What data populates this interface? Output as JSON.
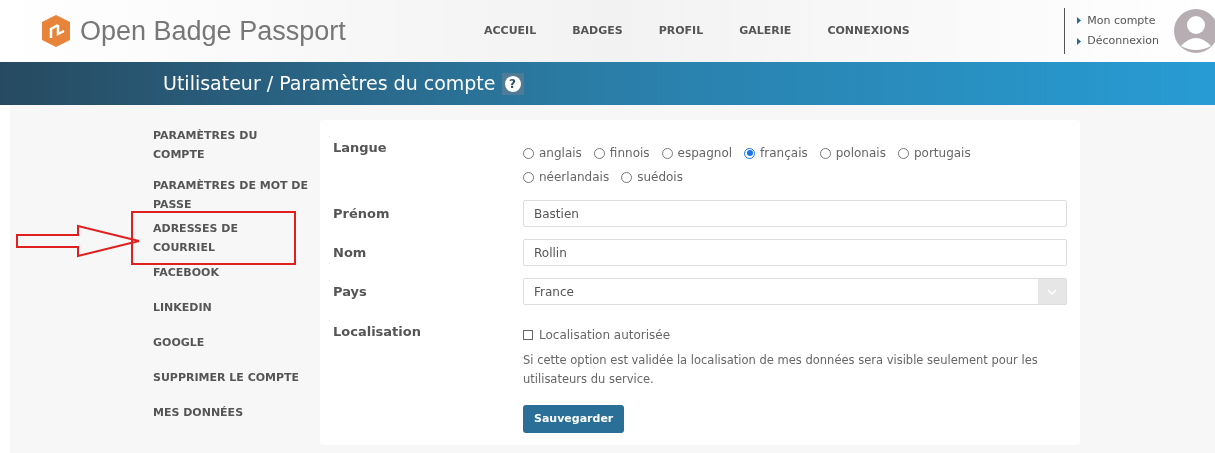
{
  "brand": {
    "name": "Open Badge Passport"
  },
  "nav": [
    {
      "label": "ACCUEIL"
    },
    {
      "label": "BADGES"
    },
    {
      "label": "PROFIL"
    },
    {
      "label": "GALERIE"
    },
    {
      "label": "CONNEXIONS"
    }
  ],
  "account_links": [
    {
      "label": "Mon compte"
    },
    {
      "label": "Déconnexion"
    }
  ],
  "page_title": "Utilisateur / Paramètres du compte",
  "help_icon": "?",
  "sidebar": {
    "items": [
      {
        "label": "PARAMÈTRES DU COMPTE",
        "highlighted": false
      },
      {
        "label": "PARAMÈTRES DE MOT DE PASSE",
        "highlighted": false
      },
      {
        "label": "ADRESSES DE COURRIEL",
        "highlighted": true
      },
      {
        "label": "FACEBOOK",
        "highlighted": false
      },
      {
        "label": "LINKEDIN",
        "highlighted": false
      },
      {
        "label": "GOOGLE",
        "highlighted": false
      },
      {
        "label": "SUPPRIMER LE COMPTE",
        "highlighted": false
      },
      {
        "label": "MES DONNÉES",
        "highlighted": false
      }
    ]
  },
  "form": {
    "language": {
      "label": "Langue",
      "options": [
        {
          "label": "anglais",
          "selected": false
        },
        {
          "label": "finnois",
          "selected": false
        },
        {
          "label": "espagnol",
          "selected": false
        },
        {
          "label": "français",
          "selected": true
        },
        {
          "label": "polonais",
          "selected": false
        },
        {
          "label": "portugais",
          "selected": false
        },
        {
          "label": "néerlandais",
          "selected": false
        },
        {
          "label": "suédois",
          "selected": false
        }
      ]
    },
    "first_name": {
      "label": "Prénom",
      "value": "Bastien"
    },
    "last_name": {
      "label": "Nom",
      "value": "Rollin"
    },
    "country": {
      "label": "Pays",
      "value": "France"
    },
    "location": {
      "label": "Localisation",
      "checkbox_label": "Localisation autorisée",
      "checked": false,
      "help": "Si cette option est validée la localisation de mes données sera visible seulement pour les utilisateurs du service."
    },
    "save_button": "Sauvegarder"
  }
}
